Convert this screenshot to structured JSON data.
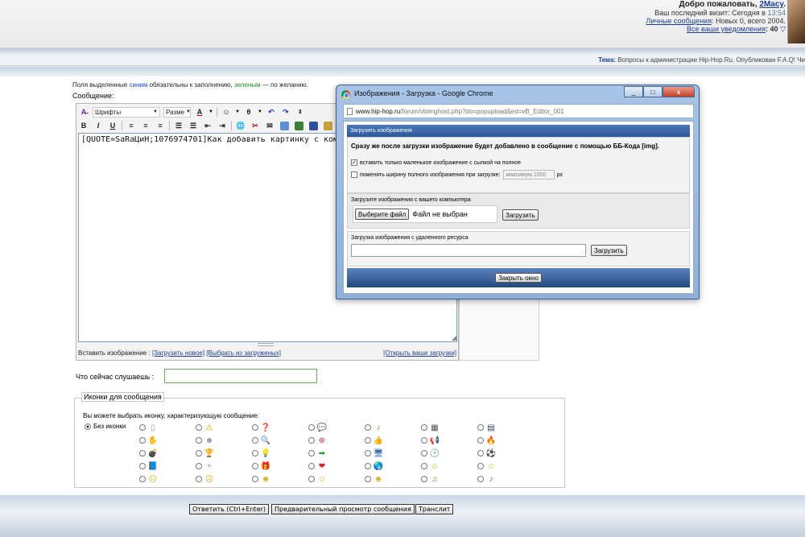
{
  "header": {
    "welcome": "Добро пожаловать,",
    "username": "2Macy",
    "last_visit": "Ваш последний визит: Сегодня в",
    "last_visit_time": "13:54",
    "pm_link": "Личные сообщения",
    "pm_stats": ": Новых 0, всего 2004.",
    "notifications_link": "Все ваши уведомления",
    "notifications_count": ": 40"
  },
  "theme_line": {
    "label": "Тема:",
    "text": "Вопросы к администрации Hip-Hop.Ru. Опубликован F.A.Q! Чи"
  },
  "form": {
    "hint_pre": "Поля выделенные",
    "hint_blue": "синим",
    "hint_mid": "обязательны к заполнению,",
    "hint_green": "зеленым",
    "hint_post": "— по желанию.",
    "message_label": "Сообщение:",
    "font_select": "Шрифты",
    "size_select": "Разме",
    "textarea_value": "[QUOTE=SaRaЦиН;1076974701]Как добавить картинку с компа",
    "insert_image_label": "Вставить изображение :",
    "upload_new": "[Загрузить новое]",
    "choose_uploaded": "[Выбрать из загруженых]",
    "open_uploads": "[Открыть ваши загрузки]",
    "listening_label": "Что сейчас слушаешь :",
    "listening_value": ""
  },
  "icons": {
    "legend": "Иконки для сообщения",
    "description": "Вы можете выбрать иконку, характеризующую сообщение:",
    "no_icons": "Без иконки"
  },
  "buttons": {
    "reply": "Ответить (Ctrl+Enter)",
    "preview": "Предварительный просмотр сообщения",
    "translit": "Транслит"
  },
  "popup": {
    "title": "Изображения - Загрузка - Google Chrome",
    "url_domain": "www.hip-hop.ru",
    "url_path": "/forum/vbimghost.php?do=popupload&ed=vB_Editor_001",
    "section_header": "Загрузить изображения",
    "notice": "Сразу же после загрузки изображение будет добавлено в сообщение с помощью ББ-Кода [img].",
    "check1": "вставить только маленькое изображение с сылкой на полное",
    "check2": "поменять ширину полного изображения при загрузке:",
    "max_placeholder": "максимум 1000",
    "px": "px",
    "local_label": "Загрузите изображения с вашего компьютера",
    "choose_file": "Выберите файл",
    "no_file": "Файл не выбран",
    "upload1": "Загрузить",
    "remote_label": "Загрузка изображения с удаленного ресурса",
    "upload2": "Загрузить",
    "close": "Закрыть окно",
    "minimize": "_",
    "maximize": "□",
    "close_x": "x"
  },
  "colors": {
    "link_blue": "#1c3f94",
    "section_blue": "#2e5a9c",
    "listening_border": "#6cab5b"
  }
}
